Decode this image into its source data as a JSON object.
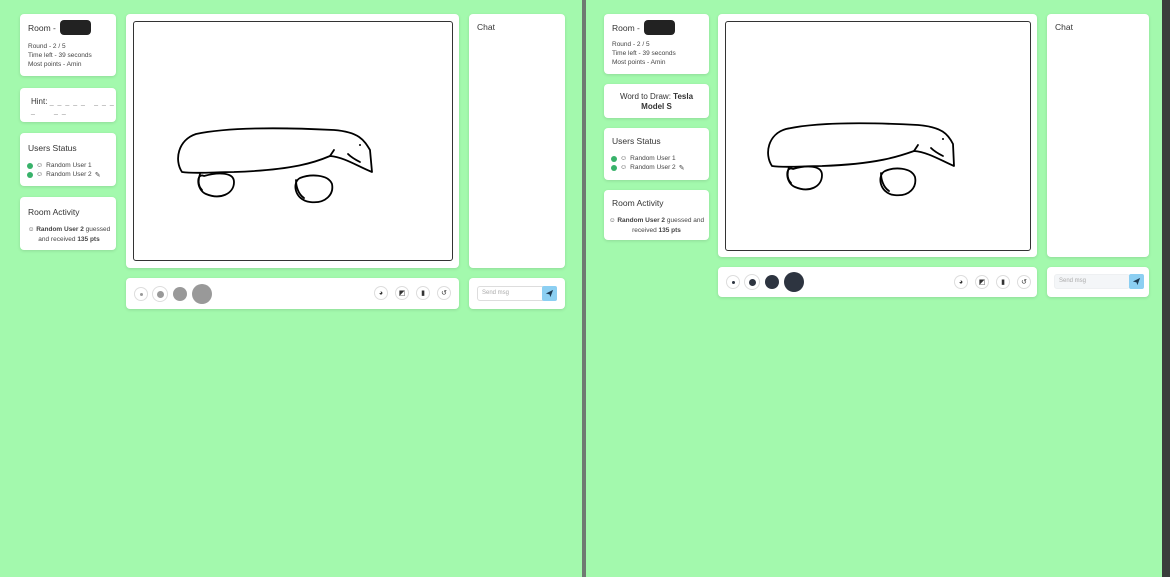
{
  "left": {
    "room": {
      "label": "Room -"
    },
    "stats": {
      "round": "Round - 2 / 5",
      "time_left": "Time left - 39 seconds",
      "most_points": "Most points - Amin"
    },
    "hint": {
      "label": "Hint:",
      "blanks_1": "_ _ _ _ _",
      "blanks_2": "_ _ _ _",
      "blanks_3": "_ _"
    },
    "users": {
      "title": "Users Status",
      "user1": "Random User 1",
      "user2": "Random User 2"
    },
    "activity": {
      "title": "Room Activity",
      "user": "Random User 2",
      "text1": " guessed",
      "text2": "and received ",
      "pts": "135 pts"
    },
    "chat": {
      "title": "Chat",
      "placeholder": "Send msg"
    }
  },
  "right": {
    "room": {
      "label": "Room -"
    },
    "stats": {
      "round": "Round - 2 / 5",
      "time_left": "Time left - 39 seconds",
      "most_points": "Most points - Amin"
    },
    "word": {
      "label": "Word to Draw: ",
      "word_a": "Tesla",
      "word_b": "Model S"
    },
    "users": {
      "title": "Users Status",
      "user1": "Random User 1",
      "user2": "Random User 2"
    },
    "activity": {
      "title": "Room Activity",
      "user": "Random User 2",
      "text1": " guessed and",
      "text2": "received ",
      "pts": "135 pts"
    },
    "chat": {
      "title": "Chat",
      "placeholder": "Send msg"
    }
  },
  "icons": {
    "palette": "palette-icon",
    "eraser": "eraser-icon",
    "trash": "trash-icon",
    "undo": "undo-icon",
    "send": "send-icon",
    "check": "check-circle-icon",
    "pencil": "pencil-icon",
    "avatar": "avatar-icon"
  },
  "colors": {
    "background": "#a3f9ad",
    "send": "#8ccff2",
    "check": "#38b26a",
    "brush_left": "#999999",
    "brush_right": "#2d3440"
  }
}
